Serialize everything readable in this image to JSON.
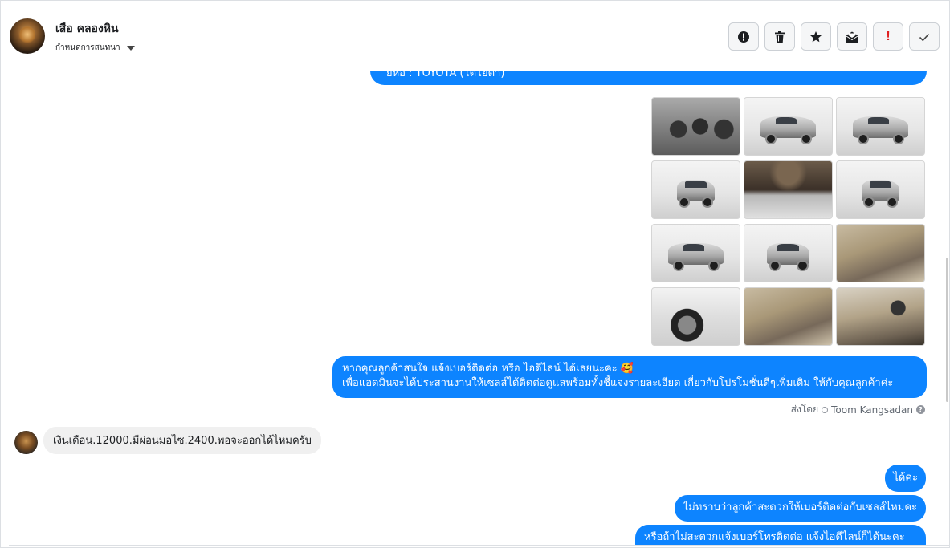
{
  "header": {
    "user_name": "เสือ คลองหิน",
    "status_label": "กำหนดการสนทนา",
    "actions": [
      {
        "name": "report-button",
        "icon": "alert-circle-icon"
      },
      {
        "name": "delete-button",
        "icon": "trash-icon"
      },
      {
        "name": "star-button",
        "icon": "star-icon"
      },
      {
        "name": "mark-unread-button",
        "icon": "open-envelope-icon"
      },
      {
        "name": "priority-button",
        "icon": "exclamation-icon"
      },
      {
        "name": "done-button",
        "icon": "check-icon"
      }
    ]
  },
  "messages": {
    "top_cut_text": "ยี่ห้อ : TOYOTA (โตโยต้า)",
    "photos": [
      {
        "label": "dashboard"
      },
      {
        "label": "side-silver-pickup"
      },
      {
        "label": "side-silver-pickup"
      },
      {
        "label": "front-pickup"
      },
      {
        "label": "undercarriage"
      },
      {
        "label": "front-pickup"
      },
      {
        "label": "front-angle-pickup"
      },
      {
        "label": "rear-pickup"
      },
      {
        "label": "interior-seats"
      },
      {
        "label": "wheel"
      },
      {
        "label": "interior-seats"
      },
      {
        "label": "interior-dashboard"
      }
    ],
    "long_line1": "หากคุณลูกค้าสนใจ แจ้งเบอร์ติดต่อ หรือ ไอดีไลน์ ได้เลยนะคะ 🥰",
    "long_line2": "เพื่อแอดมินจะได้ประสานงานให้เซลส์ได้ติดต่อดูแลพร้อมทั้งชี้แจงรายละเอียด เกี่ยวกับโปรโมชั่นดีๆเพิ่มเติม ให้กับคุณลูกค้าค่ะ",
    "sent_by_prefix": "ส่งโดย",
    "sent_by_name": "Toom Kangsadan",
    "incoming": "เงินเดือน.12000.มีผ่อนมอไซ.2400.พอจะออกได้ไหมครับ",
    "reply1": "ได้ค่ะ",
    "reply2": "ไม่ทราบว่าลูกค้าสะดวกให้เบอร์ติดต่อกับเซลส์ไหมคะ",
    "reply3": "หรือถ้าไม่สะดวกแจ้งเบอร์โทรติดต่อ แจ้งไอดีไลน์ก็ได้นะคะ"
  }
}
